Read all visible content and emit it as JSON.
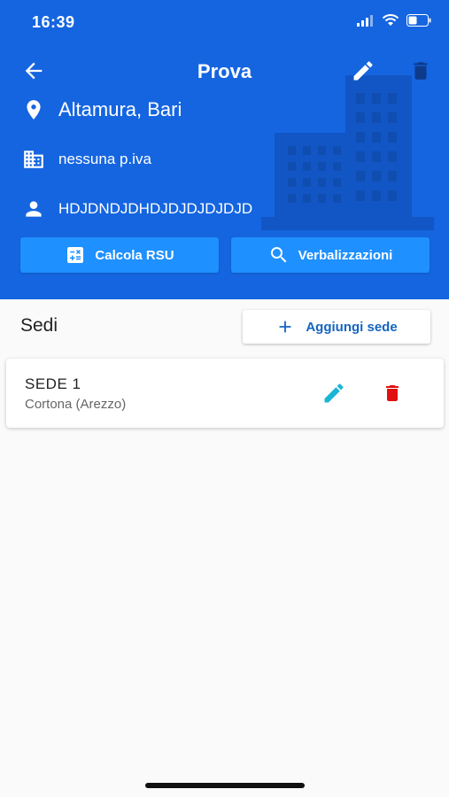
{
  "status_bar": {
    "time": "16:39"
  },
  "appbar": {
    "title": "Prova"
  },
  "company": {
    "city": "Altamura, Bari",
    "piva": "nessuna p.iva",
    "person": "HDJDNDJDHDJDJDJDJDJD"
  },
  "actions": {
    "rsu_label": "Calcola RSU",
    "verb_label": "Verbalizzazioni"
  },
  "sedi": {
    "title": "Sedi",
    "add_label": "Aggiungi sede",
    "items": [
      {
        "name": "SEDE 1",
        "location": "Cortona (Arezzo)"
      }
    ]
  },
  "colors": {
    "header_bg": "#1565e0",
    "button_bg": "#1e90ff",
    "edit_icon": "#19b5d6",
    "delete_icon": "#e01010"
  },
  "icons": [
    "back-arrow-icon",
    "pencil-icon",
    "trash-icon",
    "location-pin-icon",
    "building-icon",
    "person-icon",
    "calculator-icon",
    "search-icon",
    "plus-icon"
  ]
}
